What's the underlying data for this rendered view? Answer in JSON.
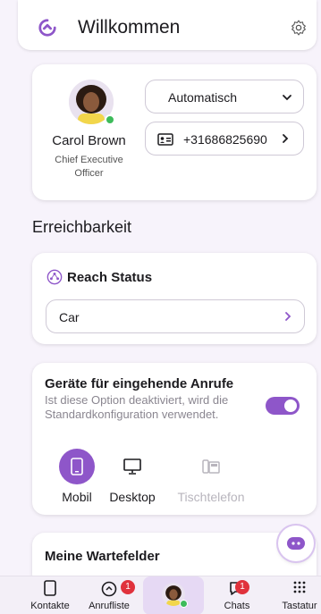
{
  "header": {
    "title": "Willkommen",
    "logo_icon": "brand-logo-icon",
    "settings_icon": "gear-icon"
  },
  "colors": {
    "accent": "#8e56c9",
    "badge": "#e0323c",
    "online": "#3dbb5a"
  },
  "profile": {
    "name": "Carol Brown",
    "role": "Chief Executive Officer",
    "status_select": "Automatisch",
    "phone": "+31686825690",
    "online": true
  },
  "reachability": {
    "section_title": "Erreichbarkeit",
    "reach_status_title": "Reach Status",
    "reach_status_value": "Car"
  },
  "devices": {
    "title": "Geräte für eingehende Anrufe",
    "description": "Ist diese Option deaktiviert, wird die Standardkonfiguration verwendet.",
    "toggle_on": true,
    "options": [
      {
        "label": "Mobil",
        "icon": "mobile-phone-icon",
        "selected": true
      },
      {
        "label": "Desktop",
        "icon": "desktop-icon",
        "selected": false
      },
      {
        "label": "Tischtelefon",
        "icon": "desk-phone-icon",
        "selected": false,
        "disabled": true
      }
    ]
  },
  "queues": {
    "title": "Meine Wartefelder"
  },
  "bottom_nav": {
    "items": [
      {
        "label": "Kontakte",
        "icon": "contacts-icon"
      },
      {
        "label": "Anrufliste",
        "icon": "call-history-icon",
        "badge": "1"
      },
      {
        "label": "",
        "icon": "avatar"
      },
      {
        "label": "Chats",
        "icon": "chats-icon",
        "badge": "1"
      },
      {
        "label": "Tastatur",
        "icon": "dialpad-icon"
      }
    ]
  }
}
